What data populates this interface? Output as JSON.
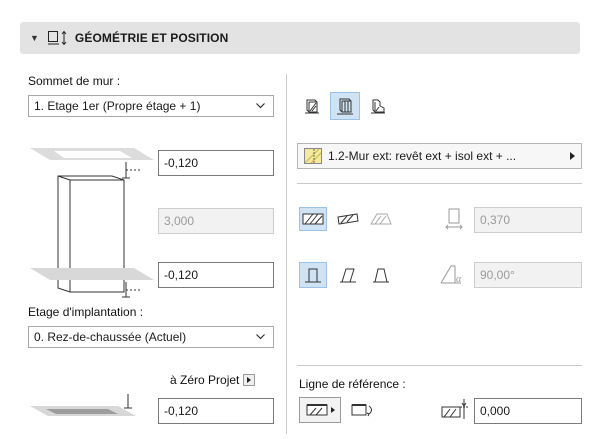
{
  "panel": {
    "title": "GÉOMÉTRIE ET POSITION",
    "collapse_icon": "collapse-caret-icon",
    "header_icon": "geometry-position-icon"
  },
  "left": {
    "top_label": "Sommet de mur :",
    "top_dropdown": "1. Etage 1er (Propre étage + 1)",
    "top_offset": "-0,120",
    "height": "3,000",
    "bottom_offset": "-0,120",
    "home_label": "Etage d'implantation :",
    "home_dropdown": "0. Rez-de-chaussée (Actuel)",
    "zero_label": "à Zéro Projet",
    "zero_value": "-0,120"
  },
  "right": {
    "structure_icons": [
      "basic-wall-icon",
      "composite-wall-icon",
      "profile-wall-icon"
    ],
    "selected_structure": "composite-wall-icon",
    "composite_label": "1.2-Mur ext: revêt ext + isol ext + ...",
    "thickness": "0,370",
    "angle": "90,00°",
    "ref_label": "Ligne de référence :",
    "ref_offset": "0,000"
  },
  "colors": {
    "header_bg": "#e3e3e3",
    "selected_bg": "#cfe3f5",
    "composite_swatch": "#f5e9a0"
  }
}
